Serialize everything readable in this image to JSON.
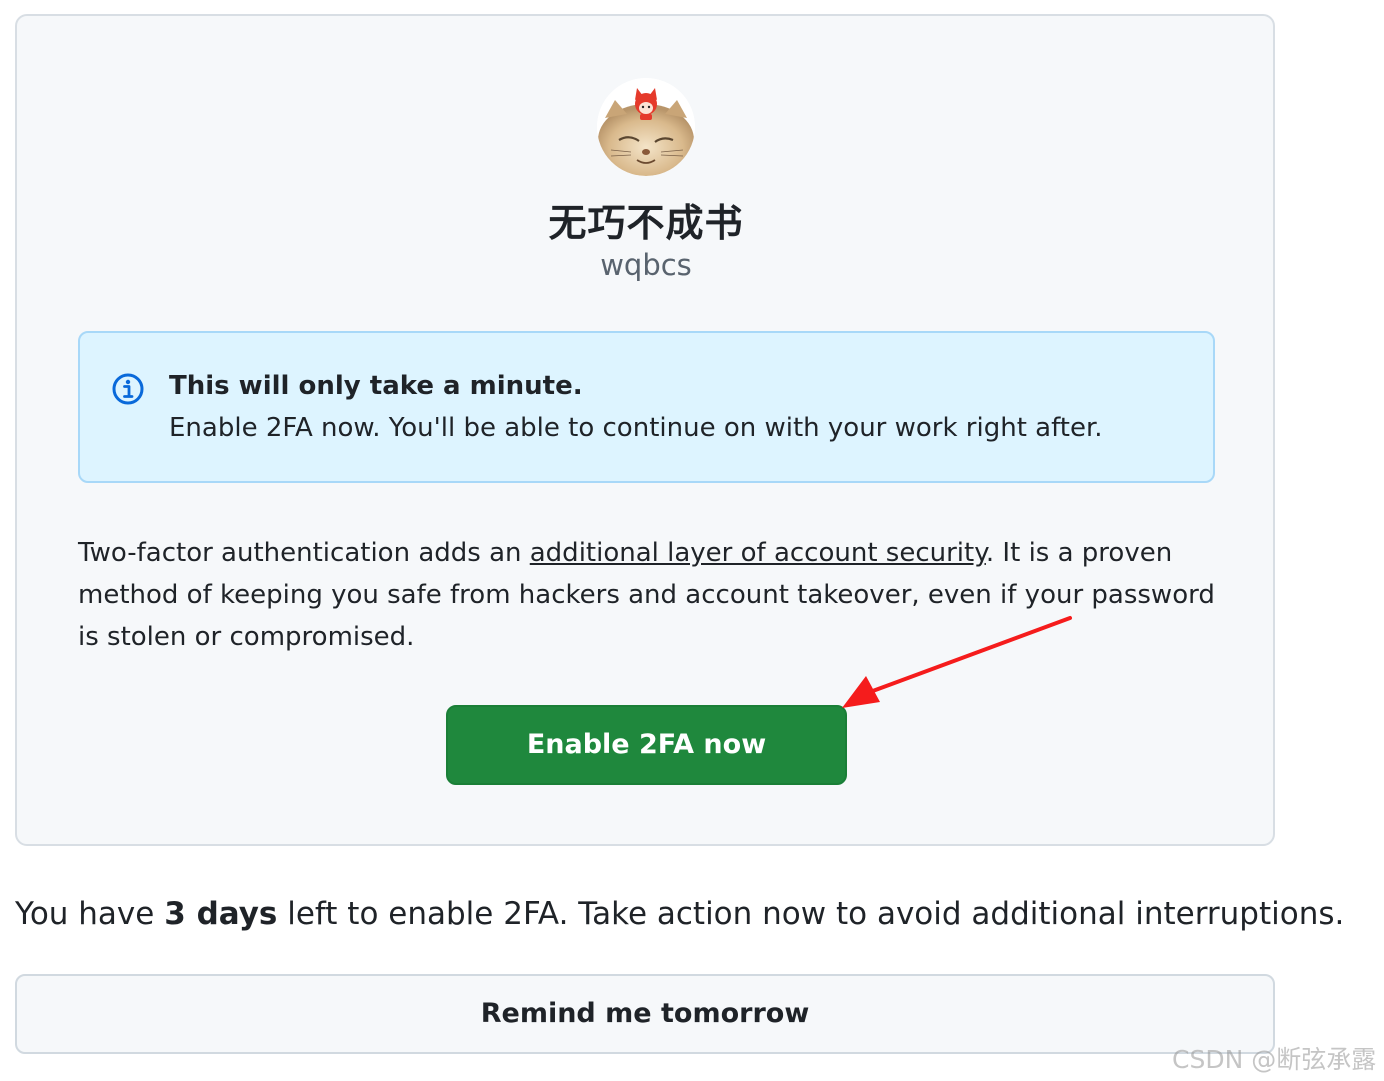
{
  "profile": {
    "display_name": "无巧不成书",
    "username": "wqbcs"
  },
  "flash": {
    "icon": "info-icon",
    "title": "This will only take a minute.",
    "body": "Enable 2FA now. You'll be able to continue on with your work right after."
  },
  "description": {
    "before_link": "Two-factor authentication adds an ",
    "link_text": "additional layer of account security",
    "after_link": ". It is a proven method of keeping you safe from hackers and account takeover, even if your password is stolen or compromised."
  },
  "enable_button": {
    "label": "Enable 2FA now"
  },
  "notice": {
    "prefix": "You have ",
    "days": "3 days",
    "suffix": " left to enable 2FA. Take action now to avoid additional interruptions."
  },
  "remind_button": {
    "label": "Remind me tomorrow"
  },
  "watermark": {
    "text": "CSDN @断弦承露"
  },
  "colors": {
    "primary_green": "#1f883d",
    "flash_bg": "#ddf4ff",
    "flash_border": "#a8d8f8",
    "info_icon": "#0969da",
    "annotation_arrow": "#f51c1c"
  }
}
